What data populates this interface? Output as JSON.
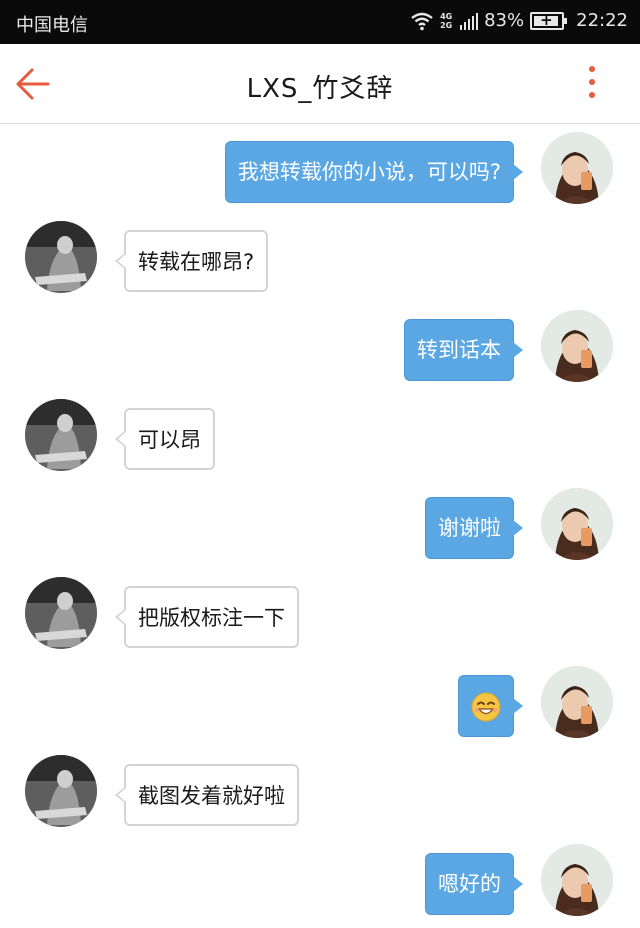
{
  "status_bar": {
    "carrier": "中国电信",
    "network_type": "4G 2G",
    "battery_percent": "83%",
    "time": "22:22"
  },
  "header": {
    "title": "LXS_竹爻辞",
    "back_icon": "back-arrow-icon",
    "more_icon": "more-vertical-icon",
    "accent_color": "#e55b3c"
  },
  "messages": [
    {
      "from": "me",
      "text": "我想转载你的小说，可以吗?"
    },
    {
      "from": "other",
      "text": "转载在哪昂?"
    },
    {
      "from": "me",
      "text": "转到话本"
    },
    {
      "from": "other",
      "text": "可以昂"
    },
    {
      "from": "me",
      "text": "谢谢啦"
    },
    {
      "from": "other",
      "text": "把版权标注一下"
    },
    {
      "from": "me",
      "emoji": "smiling-face-emoji"
    },
    {
      "from": "other",
      "text": "截图发着就好啦"
    },
    {
      "from": "me",
      "text": "嗯好的"
    }
  ],
  "colors": {
    "my_bubble": "#5aa7e3",
    "their_bubble": "#ffffff",
    "status_bar_bg": "#0a0a0a"
  }
}
